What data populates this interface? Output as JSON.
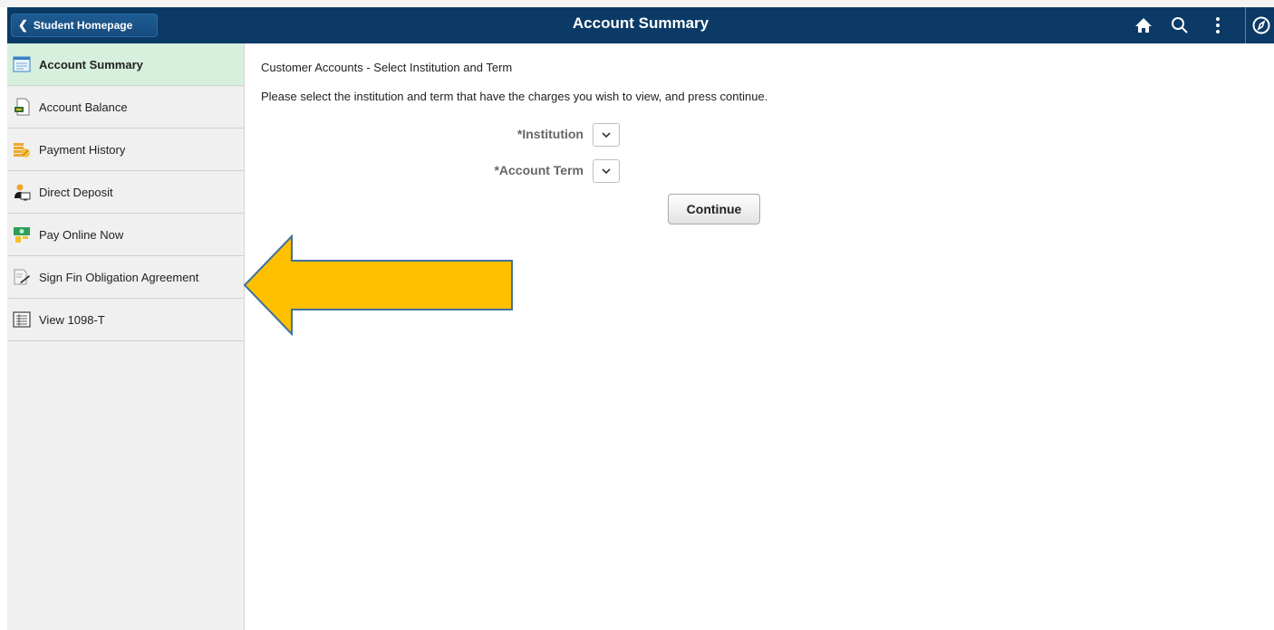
{
  "header": {
    "back_label": "Student Homepage",
    "title": "Account Summary",
    "icons": [
      "home-icon",
      "search-icon",
      "more-vertical-icon",
      "navigator-compass-icon"
    ]
  },
  "sidebar": {
    "items": [
      {
        "label": "Account Summary",
        "icon": "account-summary-icon",
        "active": true
      },
      {
        "label": "Account Balance",
        "icon": "account-balance-icon",
        "active": false
      },
      {
        "label": "Payment History",
        "icon": "payment-history-icon",
        "active": false
      },
      {
        "label": "Direct Deposit",
        "icon": "direct-deposit-icon",
        "active": false
      },
      {
        "label": "Pay Online Now",
        "icon": "pay-online-icon",
        "active": false
      },
      {
        "label": "Sign Fin Obligation Agreement",
        "icon": "sign-agreement-icon",
        "active": false
      },
      {
        "label": "View 1098-T",
        "icon": "view-1098t-icon",
        "active": false
      }
    ]
  },
  "main": {
    "heading": "Customer Accounts - Select Institution and Term",
    "instructions": "Please select the institution and term that have the charges you wish to view, and press continue.",
    "institution_label": "*Institution",
    "institution_value": "",
    "term_label": "*Account Term",
    "term_value": "",
    "continue_label": "Continue"
  },
  "colors": {
    "header_bg": "#0b3a66",
    "active_item_bg": "#d6f0dd",
    "arrow_fill": "#ffc000",
    "arrow_stroke": "#41719c"
  }
}
